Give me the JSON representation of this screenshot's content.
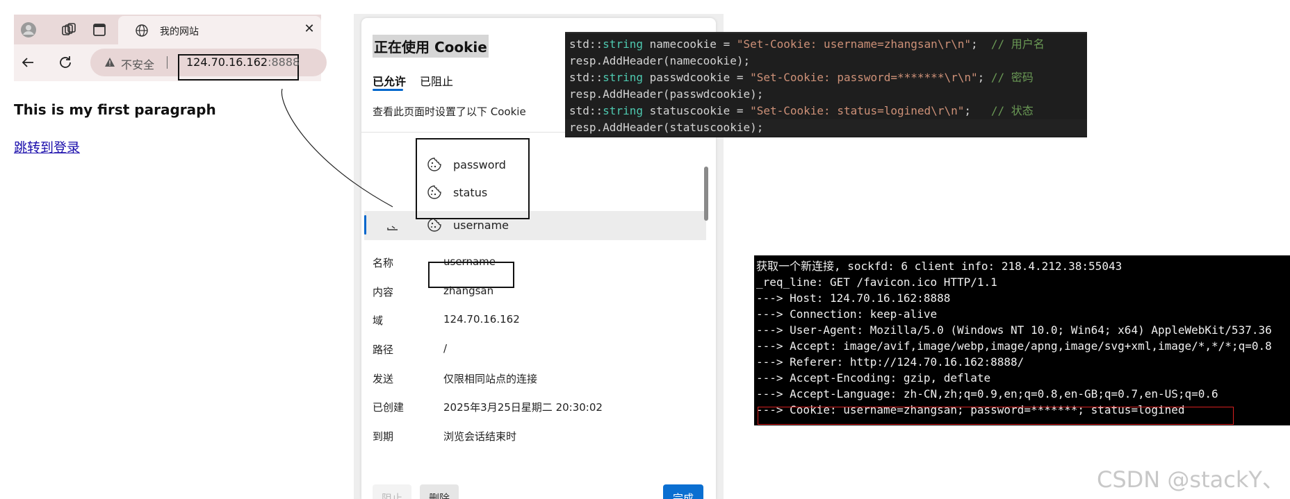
{
  "browser": {
    "tab_title": "我的网站",
    "insecure_label": "不安全",
    "url_host": "124.70.16.162",
    "url_port": ":8888",
    "icons": [
      "avatar-icon",
      "workspaces-icon",
      "sidebar-icon",
      "globe-icon",
      "close-icon",
      "back-arrow-icon",
      "reload-icon",
      "warning-icon"
    ]
  },
  "page": {
    "paragraph": "This is my first paragraph",
    "link": "跳转到登录"
  },
  "cookie_panel": {
    "title": "正在使用 Cookie",
    "tabs": [
      {
        "label": "已允许",
        "active": true
      },
      {
        "label": "已阻止",
        "active": false
      }
    ],
    "description": "查看此页面时设置了以下 Cookie",
    "cookies": [
      "password",
      "status",
      "username"
    ],
    "selected_cookie": "username",
    "details": [
      {
        "label": "名称",
        "value": "username"
      },
      {
        "label": "内容",
        "value": "zhangsan"
      },
      {
        "label": "域",
        "value": "124.70.16.162"
      },
      {
        "label": "路径",
        "value": "/"
      },
      {
        "label": "发送",
        "value": "仅限相同站点的连接"
      },
      {
        "label": "已创建",
        "value": "2025年3月25日星期二 20:30:02"
      },
      {
        "label": "到期",
        "value": "浏览会话结束时"
      }
    ],
    "buttons": {
      "block": "阻止",
      "delete": "删除",
      "done": "完成"
    },
    "accent_color": "#0b6fd1"
  },
  "code": {
    "lines": [
      {
        "pre": "std::",
        "type": "string",
        "mid": " namecookie = ",
        "str": "\"Set-Cookie: username=zhangsan\\r\\n\"",
        "post": ";  ",
        "comment": "// 用户名"
      },
      {
        "plain": "resp.AddHeader(namecookie);"
      },
      {
        "pre": "std::",
        "type": "string",
        "mid": " passwdcookie = ",
        "str": "\"Set-Cookie: password=*******\\r\\n\"",
        "post": "; ",
        "comment": "// 密码"
      },
      {
        "plain": "resp.AddHeader(passwdcookie);"
      },
      {
        "pre": "std::",
        "type": "string",
        "mid": " statuscookie = ",
        "str": "\"Set-Cookie: status=logined\\r\\n\"",
        "post": ";   ",
        "comment": "// 状态"
      },
      {
        "plain": "resp.AddHeader(statuscookie);"
      }
    ]
  },
  "terminal": {
    "lines": [
      "获取一个新连接, sockfd: 6 client info: 218.4.212.38:55043",
      "_req_line: GET /favicon.ico HTTP/1.1",
      "---> Host: 124.70.16.162:8888",
      "---> Connection: keep-alive",
      "---> User-Agent: Mozilla/5.0 (Windows NT 10.0; Win64; x64) AppleWebKit/537.36",
      "---> Accept: image/avif,image/webp,image/apng,image/svg+xml,image/*,*/*;q=0.8",
      "---> Referer: http://124.70.16.162:8888/",
      "---> Accept-Encoding: gzip, deflate",
      "---> Accept-Language: zh-CN,zh;q=0.9,en;q=0.8,en-GB;q=0.7,en-US;q=0.6",
      "---> Cookie: username=zhangsan; password=*******; status=logined"
    ]
  },
  "watermark": "CSDN @stackY、"
}
